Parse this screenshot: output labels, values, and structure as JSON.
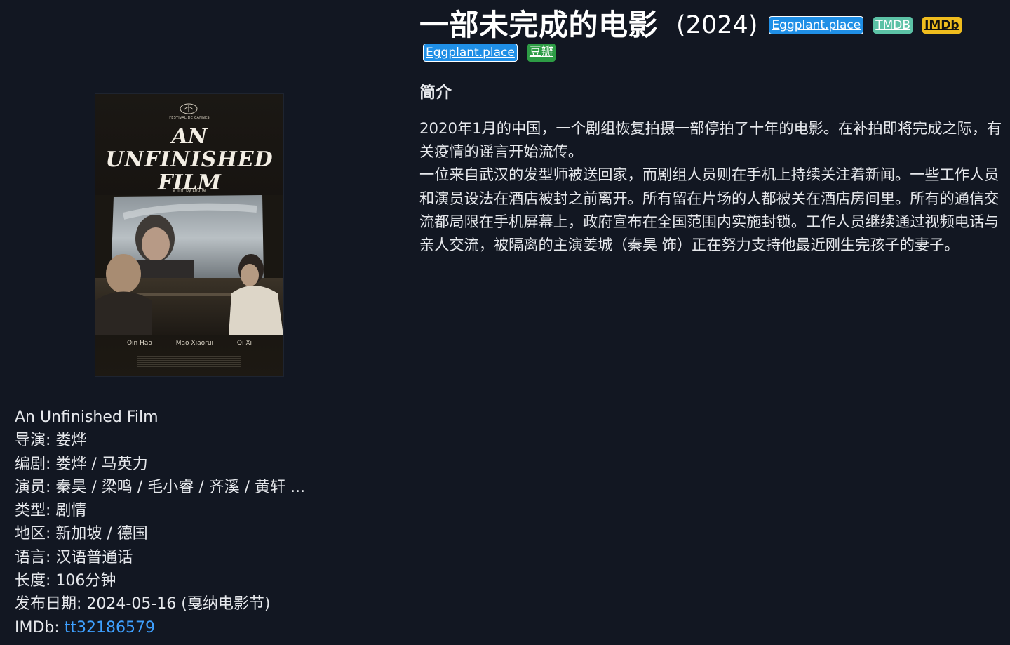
{
  "poster": {
    "festival_text": "FESTIVAL DE CANNES",
    "title_line1": "AN",
    "title_line2": "UNFINISHED",
    "title_line3": "FILM",
    "byline": "a film by Lou Ye",
    "cast": [
      "Qin Hao",
      "Mao Xiaorui",
      "Qi Xi"
    ]
  },
  "info": {
    "original_title": "An Unfinished Film",
    "director_label": "导演: ",
    "director": "娄烨",
    "writer_label": "编剧: ",
    "writer": "娄烨 / 马英力",
    "cast_label": "演员: ",
    "cast": "秦昊 / 梁鸣 / 毛小睿 / 齐溪 / 黄轩 ...",
    "genre_label": "类型: ",
    "genre": "剧情",
    "region_label": "地区: ",
    "region": "新加坡 / 德国",
    "language_label": "语言: ",
    "language": "汉语普通话",
    "runtime_label": "长度: ",
    "runtime": "106分钟",
    "release_label": "发布日期: ",
    "release": "2024-05-16 (戛纳电影节)",
    "imdb_label": "IMDb: ",
    "imdb_id": "tt32186579"
  },
  "header": {
    "title": "一部未完成的电影",
    "year": "(2024)",
    "badges": [
      {
        "label": "Eggplant.place",
        "color": "#1f8fe6"
      },
      {
        "label": "TMDB",
        "color": "#5cc2a6"
      },
      {
        "label": "IMDb",
        "color": "#f0bd1e"
      },
      {
        "label": "Eggplant.place",
        "color": "#1f8fe6"
      },
      {
        "label": "豆瓣",
        "color": "#2d9c45"
      }
    ]
  },
  "synopsis": {
    "heading": "简介",
    "paragraph1": "2020年1月的中国，一个剧组恢复拍摄一部停拍了十年的电影。在补拍即将完成之际，有关疫情的谣言开始流传。",
    "paragraph2": "一位来自武汉的发型师被送回家，而剧组人员则在手机上持续关注着新闻。一些工作人员和演员设法在酒店被封之前离开。所有留在片场的人都被关在酒店房间里。所有的通信交流都局限在手机屏幕上，政府宣布在全国范围内实施封锁。工作人员继续通过视频电话与亲人交流，被隔离的主演姜城（秦昊 饰）正在努力支持他最近刚生完孩子的妻子。"
  }
}
